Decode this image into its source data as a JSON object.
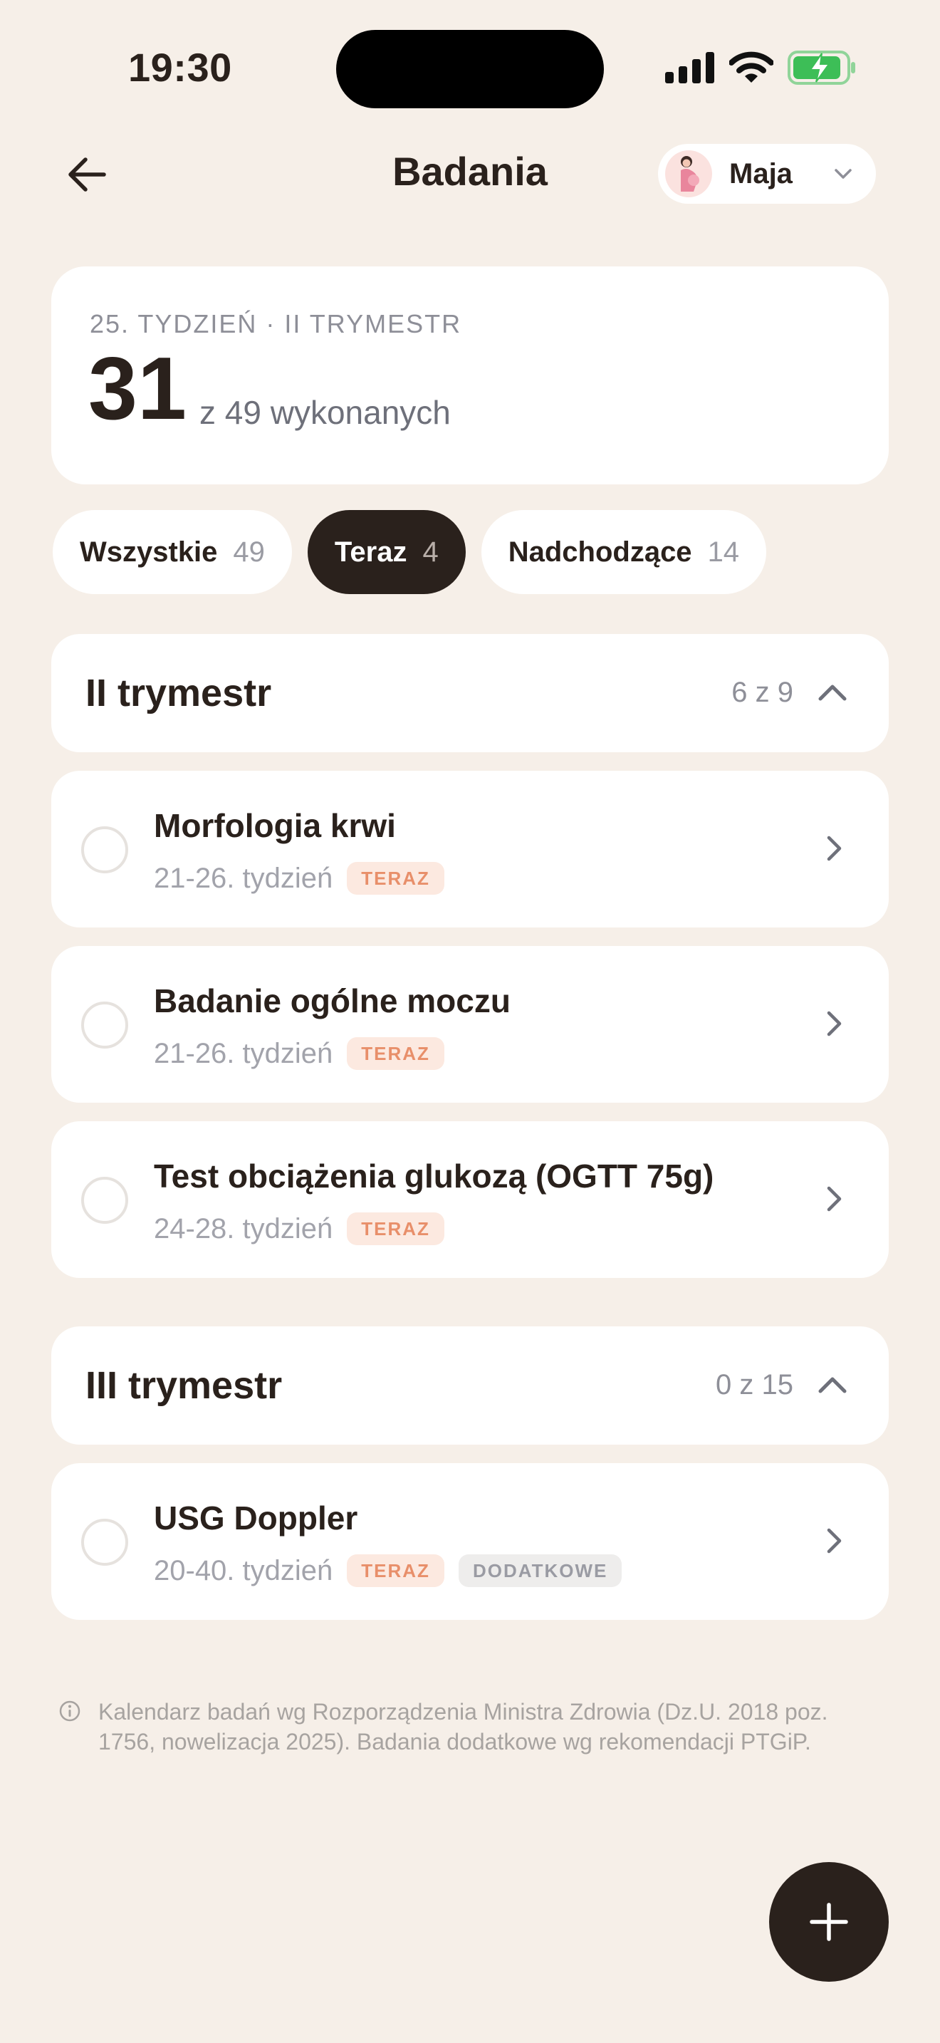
{
  "status": {
    "time": "19:30"
  },
  "header": {
    "title": "Badania",
    "profile_name": "Maja"
  },
  "summary": {
    "label": "25. TYDZIEŃ · II TRYMESTR",
    "count": "31",
    "sub": "z 49 wykonanych"
  },
  "filters": [
    {
      "label": "Wszystkie",
      "count": "49",
      "active": false
    },
    {
      "label": "Teraz",
      "count": "4",
      "active": true
    },
    {
      "label": "Nadchodzące",
      "count": "14",
      "active": false
    }
  ],
  "sections": [
    {
      "title": "II trymestr",
      "count": "6 z 9",
      "items": [
        {
          "title": "Morfologia krwi",
          "range": "21-26. tydzień",
          "badges": [
            "TERAZ"
          ]
        },
        {
          "title": "Badanie ogólne moczu",
          "range": "21-26. tydzień",
          "badges": [
            "TERAZ"
          ]
        },
        {
          "title": "Test obciążenia glukozą (OGTT 75g)",
          "range": "24-28. tydzień",
          "badges": [
            "TERAZ"
          ]
        }
      ]
    },
    {
      "title": "III trymestr",
      "count": "0 z 15",
      "items": [
        {
          "title": "USG Doppler",
          "range": "20-40. tydzień",
          "badges": [
            "TERAZ",
            "DODATKOWE"
          ]
        }
      ]
    }
  ],
  "footnote": "Kalendarz badań wg Rozporządzenia Ministra Zdrowia (Dz.U. 2018 poz. 1756, nowelizacja 2025). Badania dodatkowe wg rekomendacji PTGiP.",
  "colors": {
    "background": "#F6EFE8",
    "dark": "#2A211C",
    "badge_now": "#E88F6A",
    "battery": "#3DBE57"
  },
  "icons": {
    "back": "arrow-left-icon",
    "profile": "pregnant-woman-icon",
    "chevron_down": "chevron-down-icon",
    "collapse": "chevron-up-icon",
    "row": "chevron-right-icon",
    "info": "info-icon",
    "fab": "plus-icon"
  }
}
